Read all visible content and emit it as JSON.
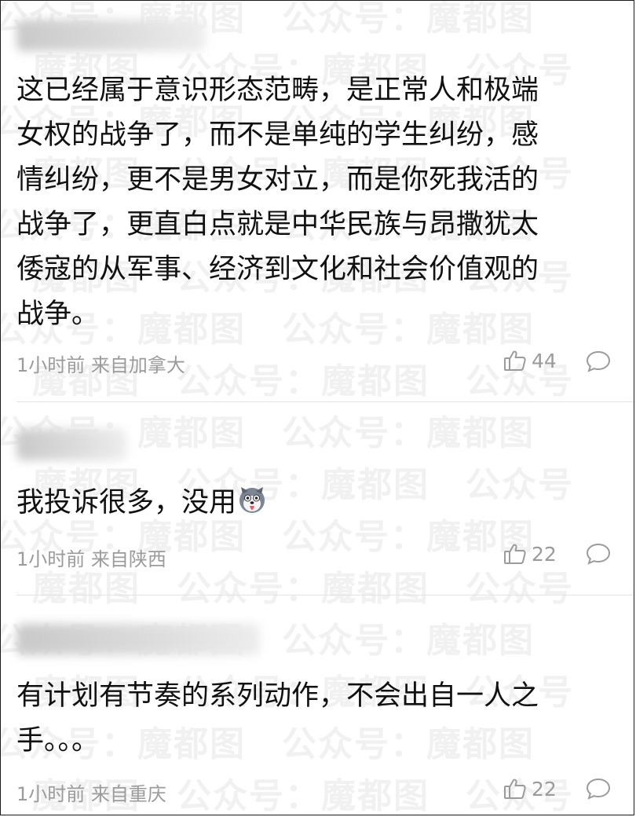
{
  "watermark": {
    "rows": [
      "公众号：魔都图　公众号：魔都图",
      "魔都图　公众号：魔都图　公众号",
      "公众号：魔都图　公众号：魔都图",
      "魔都图　公众号：魔都图　公众号",
      "公众号：魔都图　公众号：魔都图",
      "魔都图　公众号：魔都图　公众号",
      "公众号：魔都图　公众号：魔都图",
      "魔都图　公众号：魔都图　公众号",
      "公众号：魔都图　公众号：魔都图",
      "魔都图　公众号：魔都图　公众号",
      "公众号：魔都图　公众号：魔都图",
      "魔都图　公众号：魔都图　公众号",
      "公众号：魔都图　公众号：魔都图",
      "魔都图　公众号：魔都图　公众号",
      "公众号：魔都图　公众号：魔都图",
      "魔都图　公众号：魔都图　公众号"
    ]
  },
  "comments": [
    {
      "lines": [
        "这已经属于意识形态范畴，是正常人和极端",
        "女权的战争了，而不是单纯的学生纠纷，感",
        "情纠纷，更不是男女对立，而是你死我活的",
        "战争了，更直白点就是中华民族与昂撒犹太",
        "倭寇的从军事、经济到文化和社会价值观的",
        "战争。"
      ],
      "meta": "1小时前 来自加拿大",
      "likes": "44"
    },
    {
      "lines": [
        "我投诉很多，没用"
      ],
      "emoji": "husky-emoji",
      "meta": "1小时前 来自陕西",
      "likes": "22"
    },
    {
      "lines": [
        "有计划有节奏的系列动作，不会出自一人之",
        "手。。。"
      ],
      "meta": "1小时前 来自重庆",
      "likes": "22"
    }
  ],
  "icons": {
    "like": "thumbs-up-icon",
    "reply": "comment-bubble-icon"
  },
  "colors": {
    "text": "#111111",
    "meta": "#9b9b9b",
    "divider": "#e3e3e3",
    "watermark": "#f1f1f1"
  }
}
